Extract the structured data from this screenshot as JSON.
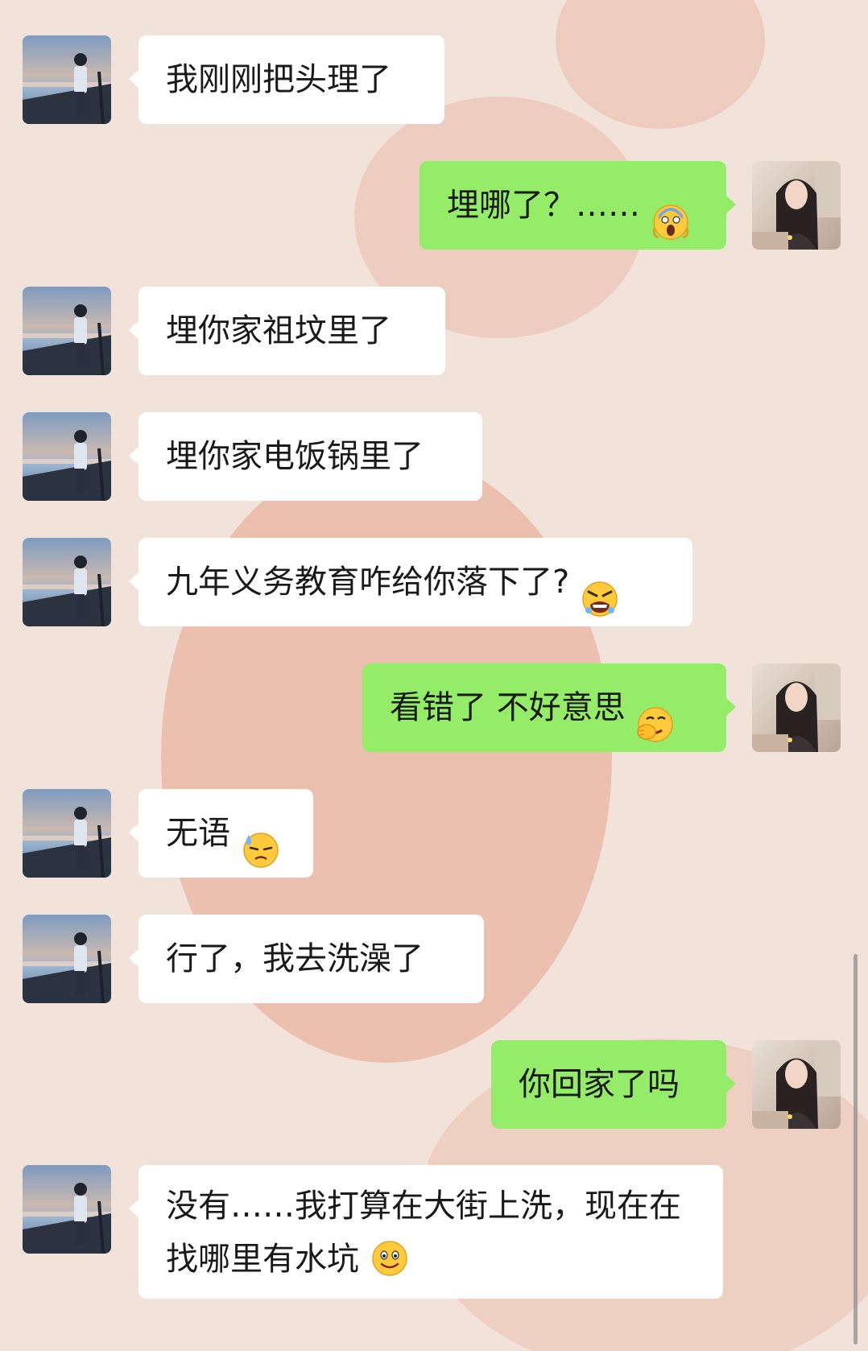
{
  "messages": [
    {
      "side": "in",
      "text": "我刚刚把头理了",
      "emoji": ""
    },
    {
      "side": "out",
      "text": "埋哪了？……",
      "emoji": "scream-emoji"
    },
    {
      "side": "in",
      "text": "埋你家祖坟里了",
      "emoji": ""
    },
    {
      "side": "in",
      "text": "埋你家电饭锅里了",
      "emoji": ""
    },
    {
      "side": "in",
      "text": "九年义务教育咋给你落下了?",
      "emoji": "angry-emoji"
    },
    {
      "side": "out",
      "text": "看错了 不好意思",
      "emoji": "facepalm-emoji"
    },
    {
      "side": "in",
      "text": "无语",
      "emoji": "sweat-emoji"
    },
    {
      "side": "in",
      "text": "行了，我去洗澡了",
      "emoji": ""
    },
    {
      "side": "out",
      "text": "你回家了吗",
      "emoji": ""
    },
    {
      "side": "in",
      "text": "没有……我打算在大街上洗，现在在找哪里有水坑",
      "emoji": "smile-emoji"
    }
  ],
  "colors": {
    "incoming_bubble": "#ffffff",
    "outgoing_bubble": "#95ec69",
    "background": "#f1e3da",
    "emoji_yellow": "#ffcb3d"
  }
}
